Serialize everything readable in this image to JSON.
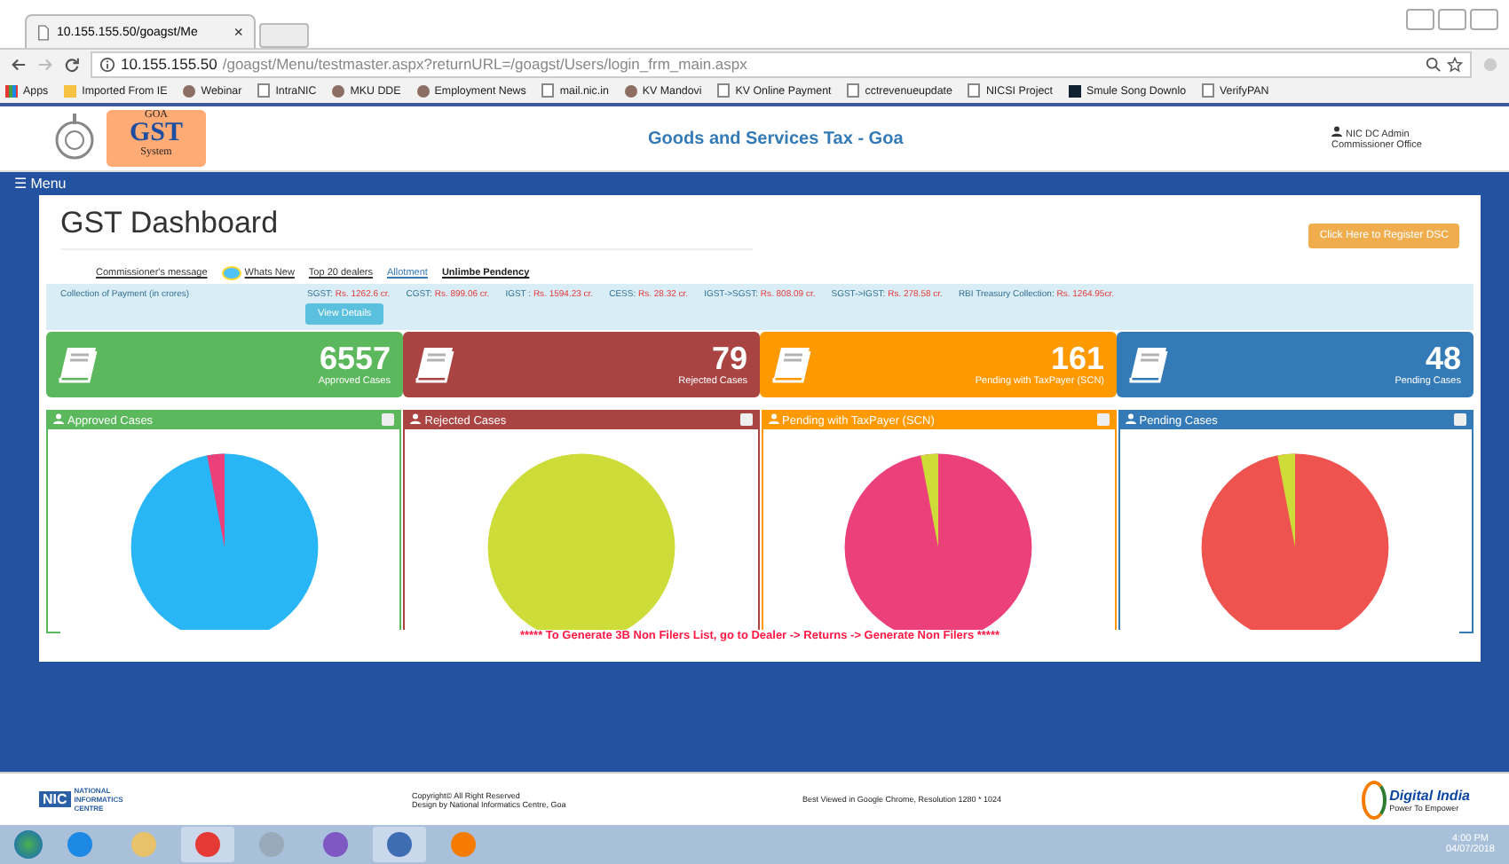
{
  "browser": {
    "tab_title": "10.155.155.50/goagst/Me",
    "close": "×",
    "url_host": "10.155.155.50",
    "url_path": "/goagst/Menu/testmaster.aspx?returnURL=/goagst/Users/login_frm_main.aspx",
    "bookmarks": [
      {
        "label": "Apps",
        "kind": "apps"
      },
      {
        "label": "Imported From IE",
        "kind": "folder"
      },
      {
        "label": "Webinar",
        "kind": "round"
      },
      {
        "label": "IntraNIC",
        "kind": "page"
      },
      {
        "label": "MKU DDE",
        "kind": "round"
      },
      {
        "label": "Employment News",
        "kind": "round"
      },
      {
        "label": "mail.nic.in",
        "kind": "page"
      },
      {
        "label": "KV Mandovi",
        "kind": "round"
      },
      {
        "label": "KV Online Payment",
        "kind": "page"
      },
      {
        "label": "cctrevenueupdate",
        "kind": "page"
      },
      {
        "label": "NICSI Project",
        "kind": "page"
      },
      {
        "label": "Smule Song Downlo",
        "kind": "square"
      },
      {
        "label": "VerifyPAN",
        "kind": "page"
      }
    ]
  },
  "header": {
    "logo_top": "GOA",
    "logo_main": "GST",
    "logo_bottom": "System",
    "title": "Goods and Services Tax - Goa",
    "user": "NIC DC Admin",
    "office": "Commissioner Office"
  },
  "menu": "☰ Menu",
  "dashboard": {
    "title": "GST Dashboard",
    "register_button": "Click Here to Register DSC",
    "links": [
      {
        "label": "Commissioner's message",
        "kind": "dark"
      },
      {
        "label": "Whats New",
        "kind": "new"
      },
      {
        "label": "Top 20 dealers",
        "kind": "dark"
      },
      {
        "label": "Allotment",
        "kind": "blue"
      },
      {
        "label": "Unlimbe Pendency",
        "kind": "bold"
      }
    ],
    "collection_label": "Collection of Payment (in crores)",
    "collections": [
      {
        "label": "SGST:",
        "value": "Rs. 1262.6 cr."
      },
      {
        "label": "CGST:",
        "value": "Rs. 899.06 cr."
      },
      {
        "label": "IGST :",
        "value": "Rs. 1594.23 cr."
      },
      {
        "label": "CESS:",
        "value": "Rs. 28.32 cr."
      },
      {
        "label": "IGST->SGST:",
        "value": "Rs. 808.09 cr."
      },
      {
        "label": "SGST->IGST:",
        "value": "Rs. 278.58 cr."
      },
      {
        "label": "RBI Treasury Collection:",
        "value": "Rs. 1264.95cr."
      }
    ],
    "view_details": "View Details",
    "cards": [
      {
        "count": "6557",
        "label": "Approved Cases",
        "color": "#5cb85c"
      },
      {
        "count": "79",
        "label": "Rejected Cases",
        "color": "#a94442"
      },
      {
        "count": "161",
        "label": "Pending with TaxPayer (SCN)",
        "color": "#ff9900"
      },
      {
        "count": "48",
        "label": "Pending Cases",
        "color": "#337ab7"
      }
    ],
    "panels": [
      {
        "title": "Approved Cases",
        "color": "#5cb85c"
      },
      {
        "title": "Rejected Cases",
        "color": "#a94442"
      },
      {
        "title": "Pending with TaxPayer (SCN)",
        "color": "#ff9900"
      },
      {
        "title": "Pending Cases",
        "color": "#337ab7"
      }
    ],
    "notice": "***** To Generate 3B Non Filers List, go to Dealer -> Returns -> Generate Non Filers *****"
  },
  "footer": {
    "nic_main": "NIC",
    "nic_sub": "NATIONAL INFORMATICS CENTRE",
    "copyright": "Copyright© All Right Reserved",
    "design": "Design by National Informatics Centre, Goa",
    "best_viewed": "Best Viewed in Google Chrome, Resolution 1280 * 1024",
    "di_title": "Digital India",
    "di_sub": "Power To Empower"
  },
  "taskbar": {
    "time": "4:00 PM",
    "date": "04/07/2018"
  }
}
